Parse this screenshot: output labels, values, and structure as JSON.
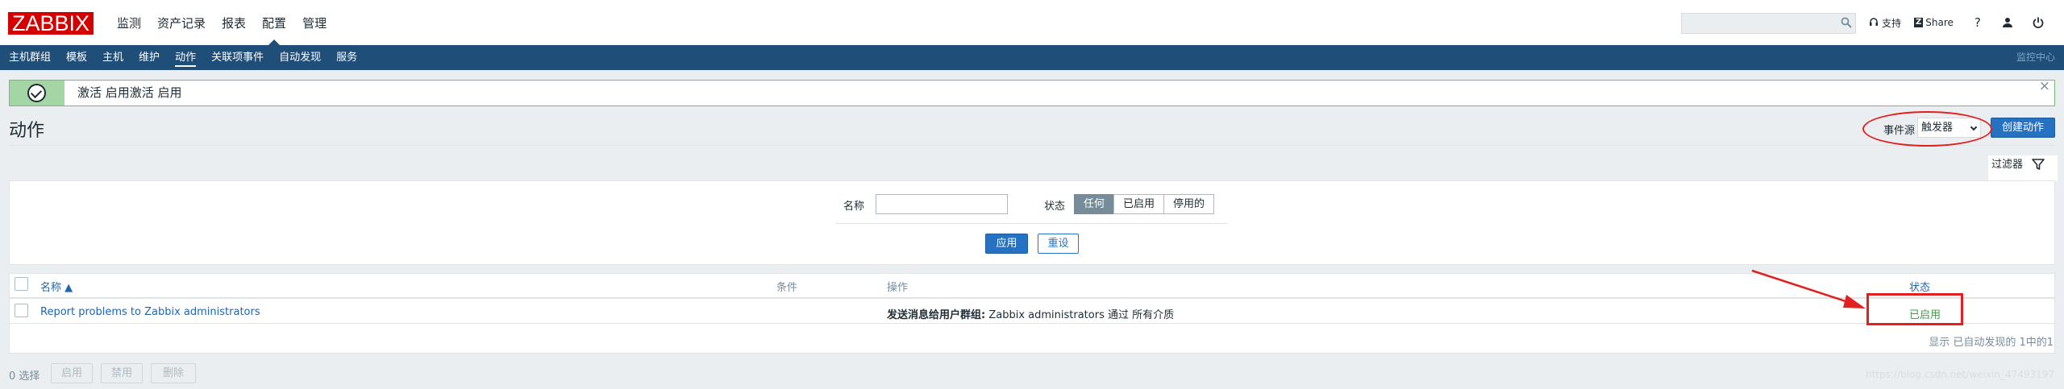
{
  "header": {
    "logo": "ZABBIX",
    "menu": [
      "监测",
      "资产记录",
      "报表",
      "配置",
      "管理"
    ],
    "active_menu": "配置",
    "links": {
      "support": "支持",
      "share": "Share",
      "help": "?"
    }
  },
  "subnav": {
    "items": [
      "主机群组",
      "模板",
      "主机",
      "维护",
      "动作",
      "关联项事件",
      "自动发现",
      "服务"
    ],
    "active": "动作",
    "right": "监控中心"
  },
  "message": {
    "text": "激活 启用激活 启用"
  },
  "page": {
    "title": "动作",
    "event_source_label": "事件源",
    "event_source_value": "触发器",
    "create_button": "创建动作"
  },
  "filter": {
    "tab_label": "过滤器",
    "name_label": "名称",
    "name_value": "",
    "status_label": "状态",
    "status_options": [
      "任何",
      "已启用",
      "停用的"
    ],
    "status_selected": "任何",
    "apply": "应用",
    "reset": "重设"
  },
  "table": {
    "columns": {
      "name": "名称 ▲",
      "conditions": "条件",
      "operations": "操作",
      "status": "状态"
    },
    "rows": [
      {
        "name": "Report problems to Zabbix administrators",
        "conditions": "",
        "operation_bold": "发送消息给用户群组:",
        "operation_rest": " Zabbix administrators 通过 所有介质",
        "status": "已启用"
      }
    ],
    "summary": "显示 已自动发现的 1中的1"
  },
  "footer": {
    "selected": "0 选择",
    "buttons": [
      "启用",
      "禁用",
      "删除"
    ]
  },
  "watermark": "https://blog.csdn.net/weixin_47493197",
  "colors": {
    "brand": "#d40000",
    "subnav": "#1f4e79",
    "primary": "#2672c2",
    "success": "#429e47",
    "annotation": "#e32020"
  }
}
